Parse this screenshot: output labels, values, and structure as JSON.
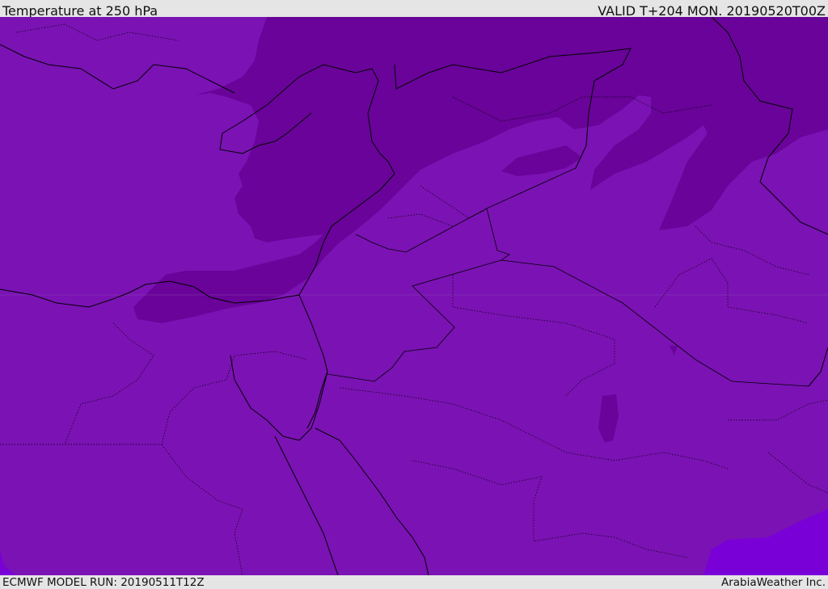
{
  "header": {
    "title": "Temperature at 250 hPa",
    "valid": "VALID T+204 MON. 20190520T00Z"
  },
  "footer": {
    "model_run": "ECMWF MODEL RUN: 20190511T12Z",
    "credit": "ArabiaWeather Inc."
  },
  "colors": {
    "base": "#7b12b4",
    "cold": "#690399",
    "warm": "#7a00d8",
    "lines": "#000000"
  }
}
